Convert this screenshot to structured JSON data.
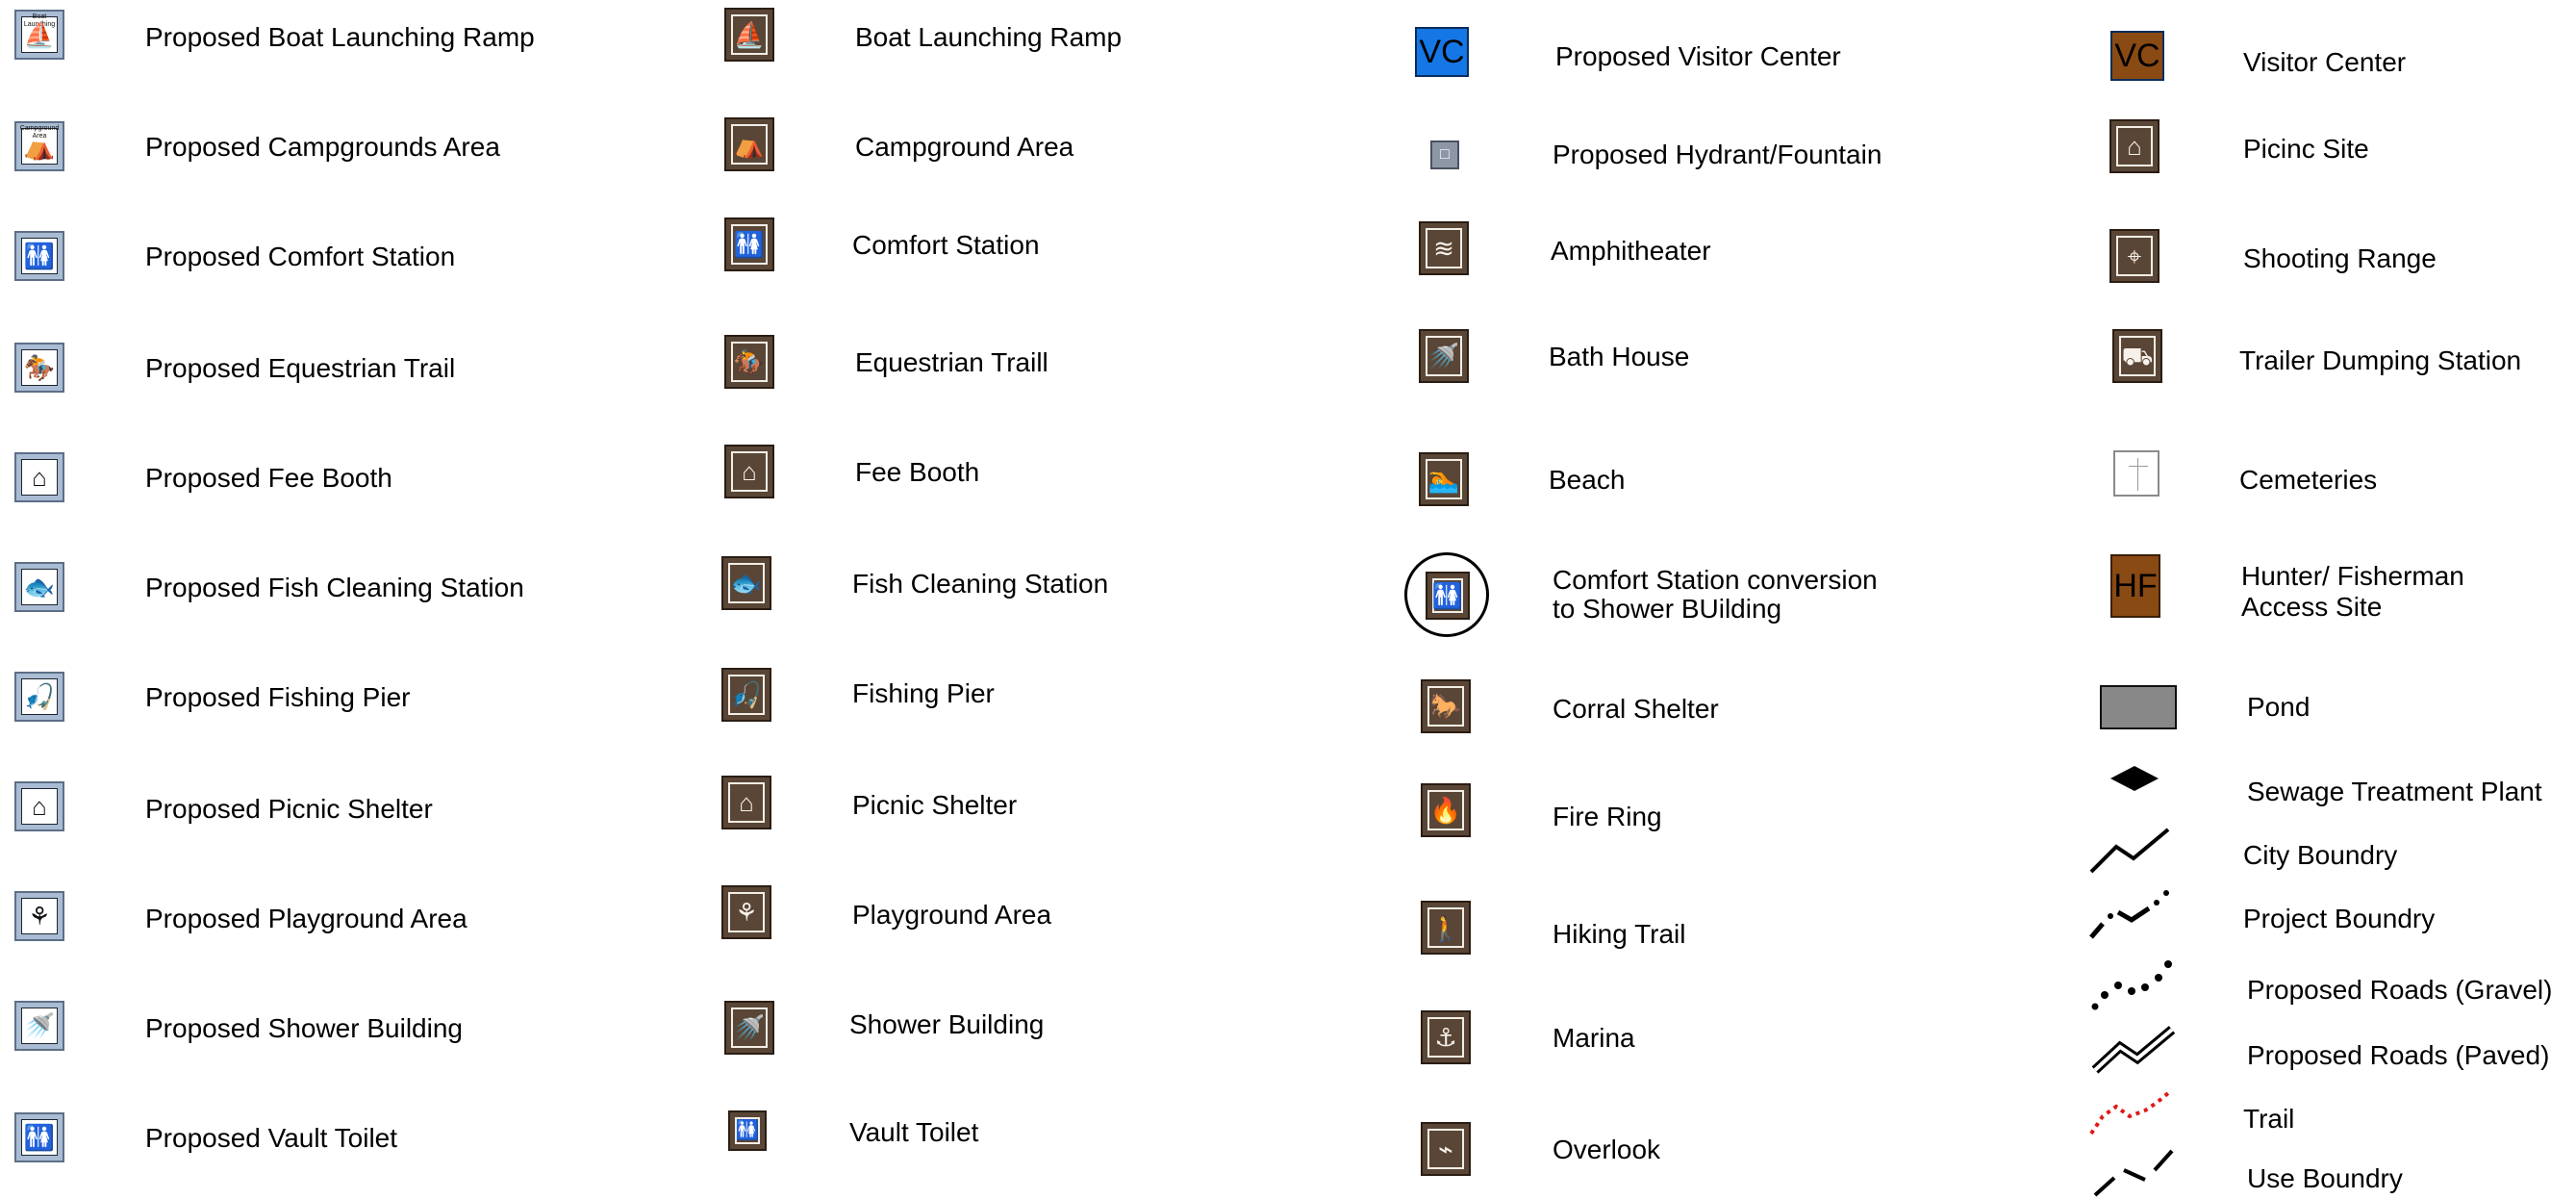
{
  "colors": {
    "proposed_icon_bg": "#a9bcd3",
    "existing_icon_bg": "#5a4636",
    "visitor_center_proposed": "#1577e6",
    "visitor_center_existing": "#8a4a14",
    "hunter_fisherman": "#8a4a14",
    "pond": "#888888",
    "trail": "#e01818"
  },
  "legend": {
    "col1": [
      {
        "label": "Proposed Boat Launching Ramp",
        "icon": "boat-launch-icon",
        "glyph": "⛵",
        "tag": "Boat Launching"
      },
      {
        "label": "Proposed Campgrounds Area",
        "icon": "tent-icon",
        "glyph": "⛺",
        "tag": "Campground Area"
      },
      {
        "label": "Proposed Comfort Station",
        "icon": "restroom-icon",
        "glyph": "🚻"
      },
      {
        "label": "Proposed Equestrian Trail",
        "icon": "horse-rider-icon",
        "glyph": "🏇"
      },
      {
        "label": "Proposed Fee Booth",
        "icon": "fee-booth-icon",
        "glyph": "⌂"
      },
      {
        "label": "Proposed Fish Cleaning Station",
        "icon": "fish-icon",
        "glyph": "🐟"
      },
      {
        "label": "Proposed Fishing Pier",
        "icon": "fishing-icon",
        "glyph": "🎣"
      },
      {
        "label": "Proposed Picnic Shelter",
        "icon": "picnic-shelter-icon",
        "glyph": "⌂"
      },
      {
        "label": "Proposed Playground Area",
        "icon": "playground-icon",
        "glyph": "⚘"
      },
      {
        "label": "Proposed Shower Building",
        "icon": "shower-icon",
        "glyph": "🚿"
      },
      {
        "label": "Proposed Vault Toilet",
        "icon": "vault-toilet-icon",
        "glyph": "🚻"
      }
    ],
    "col2": [
      {
        "label": "Boat Launching Ramp",
        "icon": "boat-launch-icon",
        "glyph": "⛵"
      },
      {
        "label": "Campground Area",
        "icon": "tent-icon",
        "glyph": "⛺"
      },
      {
        "label": "Comfort Station",
        "icon": "restroom-icon",
        "glyph": "🚻"
      },
      {
        "label": "Equestrian Traill",
        "icon": "horse-rider-icon",
        "glyph": "🏇"
      },
      {
        "label": "Fee Booth",
        "icon": "fee-booth-icon",
        "glyph": "⌂"
      },
      {
        "label": "Fish Cleaning Station",
        "icon": "fish-icon",
        "glyph": "🐟"
      },
      {
        "label": "Fishing Pier",
        "icon": "fishing-icon",
        "glyph": "🎣"
      },
      {
        "label": "Picnic Shelter",
        "icon": "picnic-shelter-icon",
        "glyph": "⌂"
      },
      {
        "label": "Playground Area",
        "icon": "playground-icon",
        "glyph": "⚘"
      },
      {
        "label": "Shower Building",
        "icon": "shower-icon",
        "glyph": "🚿"
      },
      {
        "label": "Vault Toilet",
        "icon": "vault-toilet-icon",
        "glyph": "🚻"
      }
    ],
    "col3": [
      {
        "label": "Proposed Visitor Center",
        "icon": "visitor-center-proposed-icon",
        "text": "VC"
      },
      {
        "label": "Proposed Hydrant/Fountain",
        "icon": "hydrant-icon",
        "glyph": "□"
      },
      {
        "label": "Amphitheater",
        "icon": "amphitheater-icon",
        "glyph": "≋"
      },
      {
        "label": "Bath House",
        "icon": "bath-house-icon",
        "glyph": "🚿"
      },
      {
        "label": "Beach",
        "icon": "beach-icon",
        "glyph": "🏊"
      },
      {
        "label": "Comfort Station conversion",
        "label2": "to Shower BUilding",
        "icon": "restroom-icon",
        "glyph": "🚻"
      },
      {
        "label": "Corral Shelter",
        "icon": "corral-icon",
        "glyph": "🐎"
      },
      {
        "label": "Fire Ring",
        "icon": "fire-ring-icon",
        "glyph": "🔥"
      },
      {
        "label": "Hiking Trail",
        "icon": "hiker-icon",
        "glyph": "🚶"
      },
      {
        "label": "Marina",
        "icon": "anchor-icon",
        "glyph": "⚓"
      },
      {
        "label": "Overlook",
        "icon": "overlook-icon",
        "glyph": "⌁"
      }
    ],
    "col4": [
      {
        "label": "Visitor Center",
        "icon": "visitor-center-icon",
        "text": "VC"
      },
      {
        "label": "Picinc Site",
        "icon": "picnic-table-icon",
        "glyph": "⌂"
      },
      {
        "label": "Shooting Range",
        "icon": "shooting-range-icon",
        "glyph": "⌖"
      },
      {
        "label": "Trailer Dumping Station",
        "icon": "trailer-dump-icon",
        "glyph": "⛟"
      },
      {
        "label": "Cemeteries",
        "icon": "cemetery-icon"
      },
      {
        "label": "Hunter/ Fisherman",
        "label2": "Access Site",
        "icon": "hunter-fisherman-icon",
        "text": "HF"
      },
      {
        "label": "Pond",
        "icon": "pond-icon"
      },
      {
        "label": "Sewage Treatment Plant",
        "icon": "sewage-plant-icon"
      },
      {
        "label": "City Boundry",
        "icon": "city-boundary-line-icon"
      },
      {
        "label": "Project Boundry",
        "icon": "project-boundary-line-icon"
      },
      {
        "label": "Proposed Roads (Gravel)",
        "icon": "gravel-road-line-icon"
      },
      {
        "label": "Proposed Roads (Paved)",
        "icon": "paved-road-line-icon"
      },
      {
        "label": "Trail",
        "icon": "trail-line-icon"
      },
      {
        "label": "Use Boundry",
        "icon": "use-boundary-line-icon"
      }
    ]
  }
}
